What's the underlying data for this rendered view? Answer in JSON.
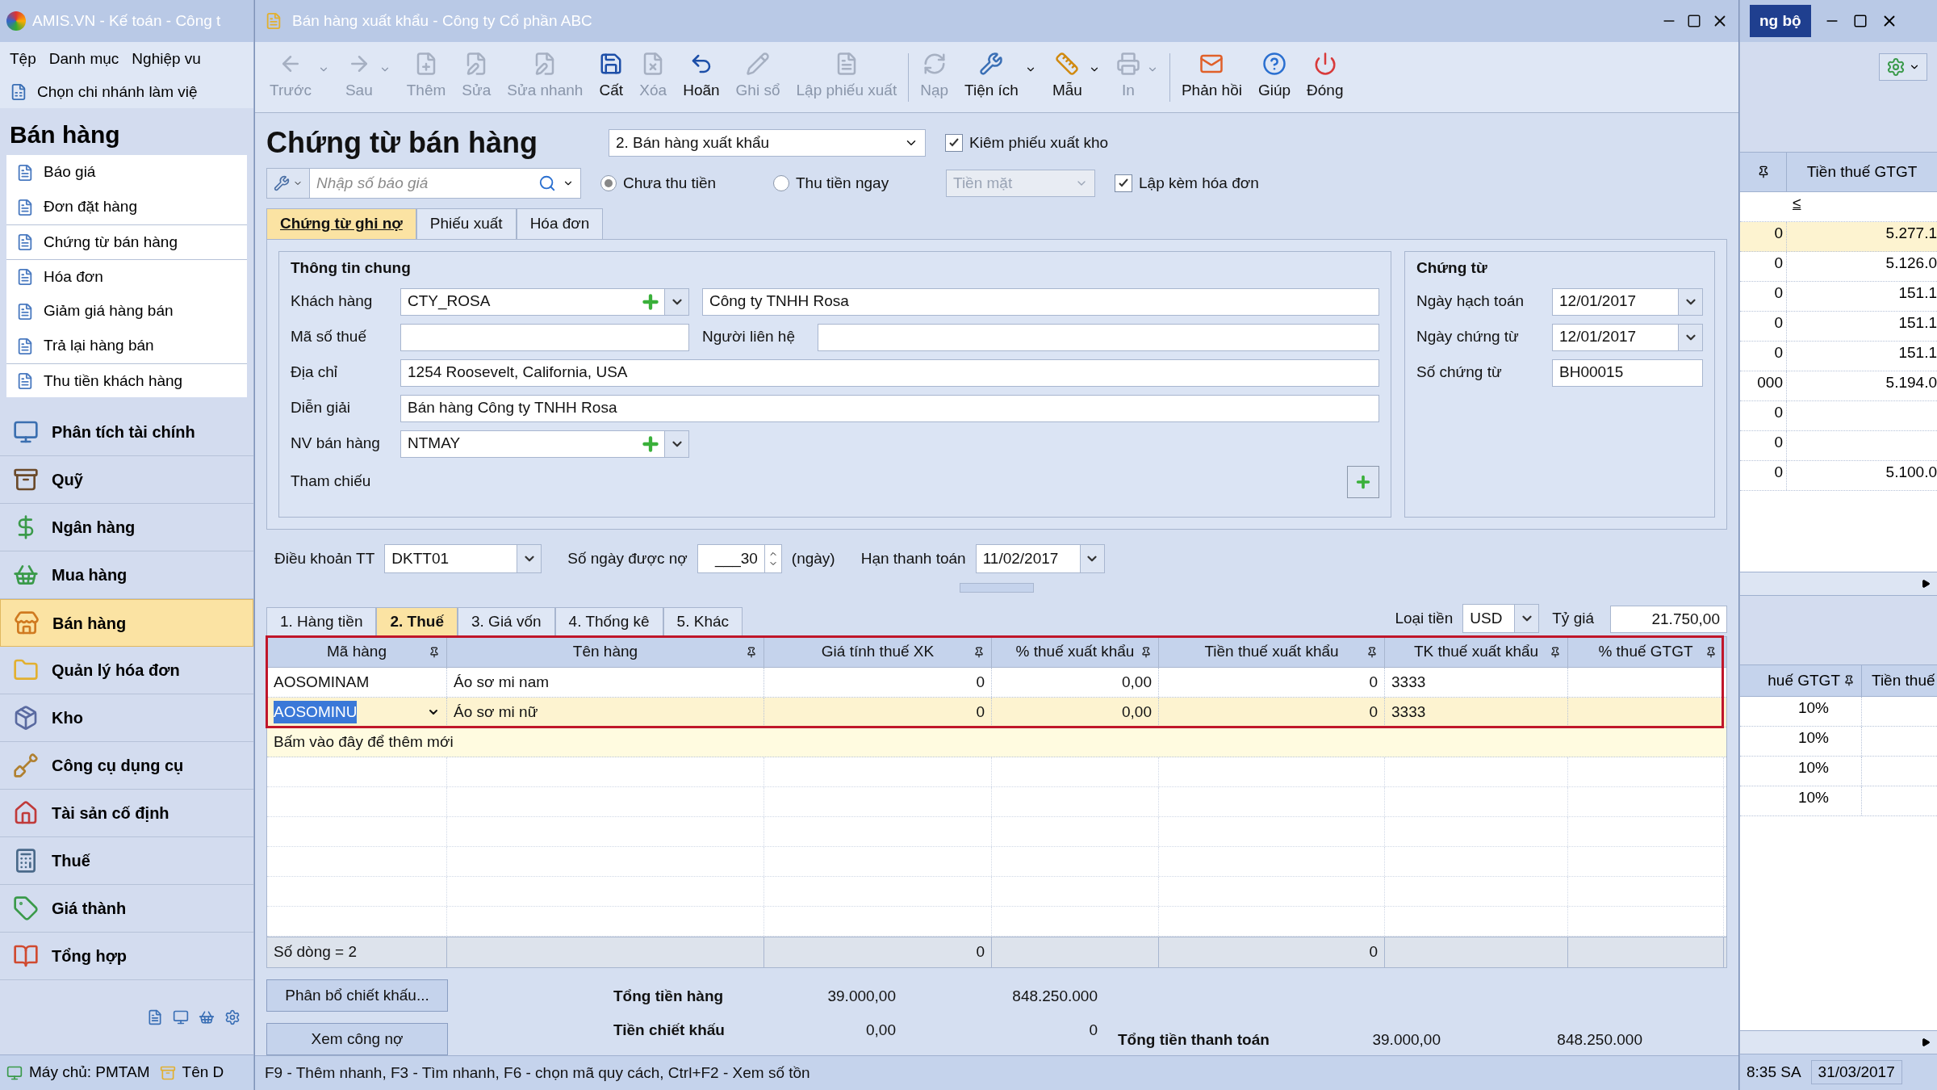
{
  "back_window": {
    "title": "AMIS.VN - Kế toán - Công t",
    "menu": [
      "Tệp",
      "Danh mục",
      "Nghiệp vu"
    ],
    "branch_label": "Chọn chi nhánh làm việ",
    "sync_button": "ng bộ",
    "sidebar": {
      "title": "Bán hàng",
      "items": [
        "Báo giá",
        "Đơn đặt hàng",
        "Chứng từ bán hàng",
        "Hóa đơn",
        "Giảm giá hàng bán",
        "Trả lại hàng bán",
        "Thu tiền khách hàng"
      ],
      "modules": [
        {
          "label": "Phân tích tài chính",
          "selected": false
        },
        {
          "label": "Quỹ",
          "selected": false
        },
        {
          "label": "Ngân hàng",
          "selected": false
        },
        {
          "label": "Mua hàng",
          "selected": false
        },
        {
          "label": "Bán hàng",
          "selected": true
        },
        {
          "label": "Quản lý hóa đơn",
          "selected": false
        },
        {
          "label": "Kho",
          "selected": false
        },
        {
          "label": "Công cụ dụng cụ",
          "selected": false
        },
        {
          "label": "Tài sản cố định",
          "selected": false
        },
        {
          "label": "Thuế",
          "selected": false
        },
        {
          "label": "Giá thành",
          "selected": false
        },
        {
          "label": "Tổng hợp",
          "selected": false
        }
      ]
    },
    "upper_grid": {
      "header": "Tiền thuế GTGT",
      "filter": "≤",
      "rows": [
        {
          "column_1": "0",
          "column_2": "5.277.1",
          "selected": true
        },
        {
          "column_1": "0",
          "column_2": "5.126.0",
          "selected": false
        },
        {
          "column_1": "0",
          "column_2": "151.1",
          "selected": false
        },
        {
          "column_1": "0",
          "column_2": "151.1",
          "selected": false
        },
        {
          "column_1": "0",
          "column_2": "151.1",
          "selected": false
        },
        {
          "column_1": "000",
          "column_2": "5.194.0",
          "selected": false
        },
        {
          "column_1": "0",
          "selected": false
        },
        {
          "column_1": "0",
          "selected": false
        },
        {
          "column_1": "0",
          "column_2": "5.100.0",
          "selected": false
        }
      ]
    },
    "lower_grid": {
      "columns": [
        "huế GTGT",
        "Tiền thuế"
      ],
      "rows": [
        "10%",
        "10%",
        "10%",
        "10%"
      ]
    },
    "status": {
      "server": "Máy chủ: PMTAM",
      "database": "Tên D",
      "time": "8:35 SA",
      "date": "31/03/2017"
    }
  },
  "dialog": {
    "title": "Bán hàng xuất khẩu - Công ty Cổ phần ABC",
    "toolbar": [
      {
        "label": "Trước",
        "disabled": true,
        "dropdown": true
      },
      {
        "label": "Sau",
        "disabled": true,
        "dropdown": true
      },
      {
        "label": "Thêm",
        "disabled": true,
        "dropdown": false
      },
      {
        "label": "Sửa",
        "disabled": true,
        "dropdown": false
      },
      {
        "label": "Sửa nhanh",
        "disabled": true,
        "dropdown": false
      },
      {
        "label": "Cất",
        "disabled": false,
        "dropdown": false
      },
      {
        "label": "Xóa",
        "disabled": true,
        "dropdown": false
      },
      {
        "label": "Hoãn",
        "disabled": false,
        "dropdown": false
      },
      {
        "label": "Ghi sổ",
        "disabled": true,
        "dropdown": false
      },
      {
        "label": "Lập phiếu xuất",
        "disabled": true,
        "dropdown": false
      },
      {
        "label": "Nạp",
        "disabled": true,
        "dropdown": false
      },
      {
        "label": "Tiện ích",
        "disabled": false,
        "dropdown": true
      },
      {
        "label": "Mẫu",
        "disabled": false,
        "dropdown": true
      },
      {
        "label": "In",
        "disabled": true,
        "dropdown": true
      },
      {
        "label": "Phản hồi",
        "disabled": false,
        "dropdown": false
      },
      {
        "label": "Giúp",
        "disabled": false,
        "dropdown": false
      },
      {
        "label": "Đóng",
        "disabled": false,
        "dropdown": false
      }
    ],
    "heading": "Chứng từ bán hàng",
    "voucher_type": "2. Bán hàng xuất khẩu",
    "export_slip": {
      "label": "Kiêm phiếu xuất kho",
      "checked": true
    },
    "quote_search": {
      "placeholder": "Nhập số báo giá"
    },
    "payment_options": [
      {
        "label": "Chưa thu tiền",
        "selected": true
      },
      {
        "label": "Thu tiền ngay",
        "selected": false
      }
    ],
    "payment_method": {
      "value": "Tiền mặt",
      "disabled": true
    },
    "with_invoice": {
      "label": "Lập kèm hóa đơn",
      "checked": true
    },
    "tabs": [
      {
        "label": "Chứng từ ghi nợ",
        "selected": true
      },
      {
        "label": "Phiếu xuất",
        "selected": false
      },
      {
        "label": "Hóa đơn",
        "selected": false
      }
    ],
    "general": {
      "title": "Thông tin chung",
      "customer_label": "Khách hàng",
      "customer_code": "CTY_ROSA",
      "customer_name": "Công ty TNHH Rosa",
      "tax_code_label": "Mã số thuế",
      "contact_label": "Người liên hệ",
      "address_label": "Địa chỉ",
      "address": "1254 Roosevelt, California, USA",
      "description_label": "Diễn giải",
      "description": "Bán hàng Công ty TNHH Rosa",
      "salesperson_label": "NV bán hàng",
      "salesperson": "NTMAY",
      "reference_label": "Tham chiếu"
    },
    "voucher": {
      "title": "Chứng từ",
      "fields": [
        {
          "label": "Ngày hạch toán",
          "value": "12/01/2017",
          "kind": "date"
        },
        {
          "label": "Ngày chứng từ",
          "value": "12/01/2017",
          "kind": "date"
        },
        {
          "label": "Số chứng từ",
          "value": "BH00015",
          "kind": "text"
        }
      ]
    },
    "terms": {
      "label": "Điều khoản TT",
      "value": "DKTT01",
      "days_label": "Số ngày được nợ",
      "days": "___30",
      "days_unit": "(ngày)",
      "due_label": "Hạn thanh toán",
      "due": "11/02/2017"
    },
    "detail_tabs": [
      {
        "label": "1. Hàng tiền",
        "selected": false
      },
      {
        "label": "2. Thuế",
        "selected": true
      },
      {
        "label": "3. Giá vốn",
        "selected": false
      },
      {
        "label": "4. Thống kê",
        "selected": false
      },
      {
        "label": "5. Khác",
        "selected": false
      }
    ],
    "currency": {
      "label": "Loại tiền",
      "value": "USD",
      "rate_label": "Tỷ giá",
      "rate": "21.750,00"
    },
    "table": {
      "columns": [
        "Mã hàng",
        "Tên hàng",
        "Giá tính thuế XK",
        "% thuế xuất khẩu",
        "Tiền thuế xuất khẩu",
        "TK thuế xuất khẩu",
        "% thuế GTGT"
      ],
      "rows": [
        {
          "cells": [
            "AOSOMINAM",
            "Áo sơ mi nam",
            "0",
            "0,00",
            "0",
            "3333",
            ""
          ],
          "selected": false
        },
        {
          "cells": [
            "AOSOMINU",
            "Áo sơ mi nữ",
            "0",
            "0,00",
            "0",
            "3333",
            ""
          ],
          "selected": true
        }
      ],
      "add_row": "Bấm vào đây để thêm mới",
      "footer": {
        "row_count": "Số dòng = 2",
        "export_tax_base_total": "0",
        "export_tax_total": "0"
      }
    },
    "buttons": [
      "Phân bổ chiết khấu...",
      "Xem công nợ"
    ],
    "totals": [
      {
        "label": "Tổng tiền hàng",
        "foreign": "39.000,00",
        "local": "848.250.000"
      },
      {
        "label": "Tiền chiết khấu",
        "foreign": "0,00",
        "local": "0"
      }
    ],
    "grand_total": {
      "label": "Tổng tiền thanh toán",
      "foreign": "39.000,00",
      "local": "848.250.000"
    },
    "hint": "F9 - Thêm nhanh, F3 - Tìm nhanh, F6 - chọn mã quy cách, Ctrl+F2 - Xem số tồn"
  }
}
